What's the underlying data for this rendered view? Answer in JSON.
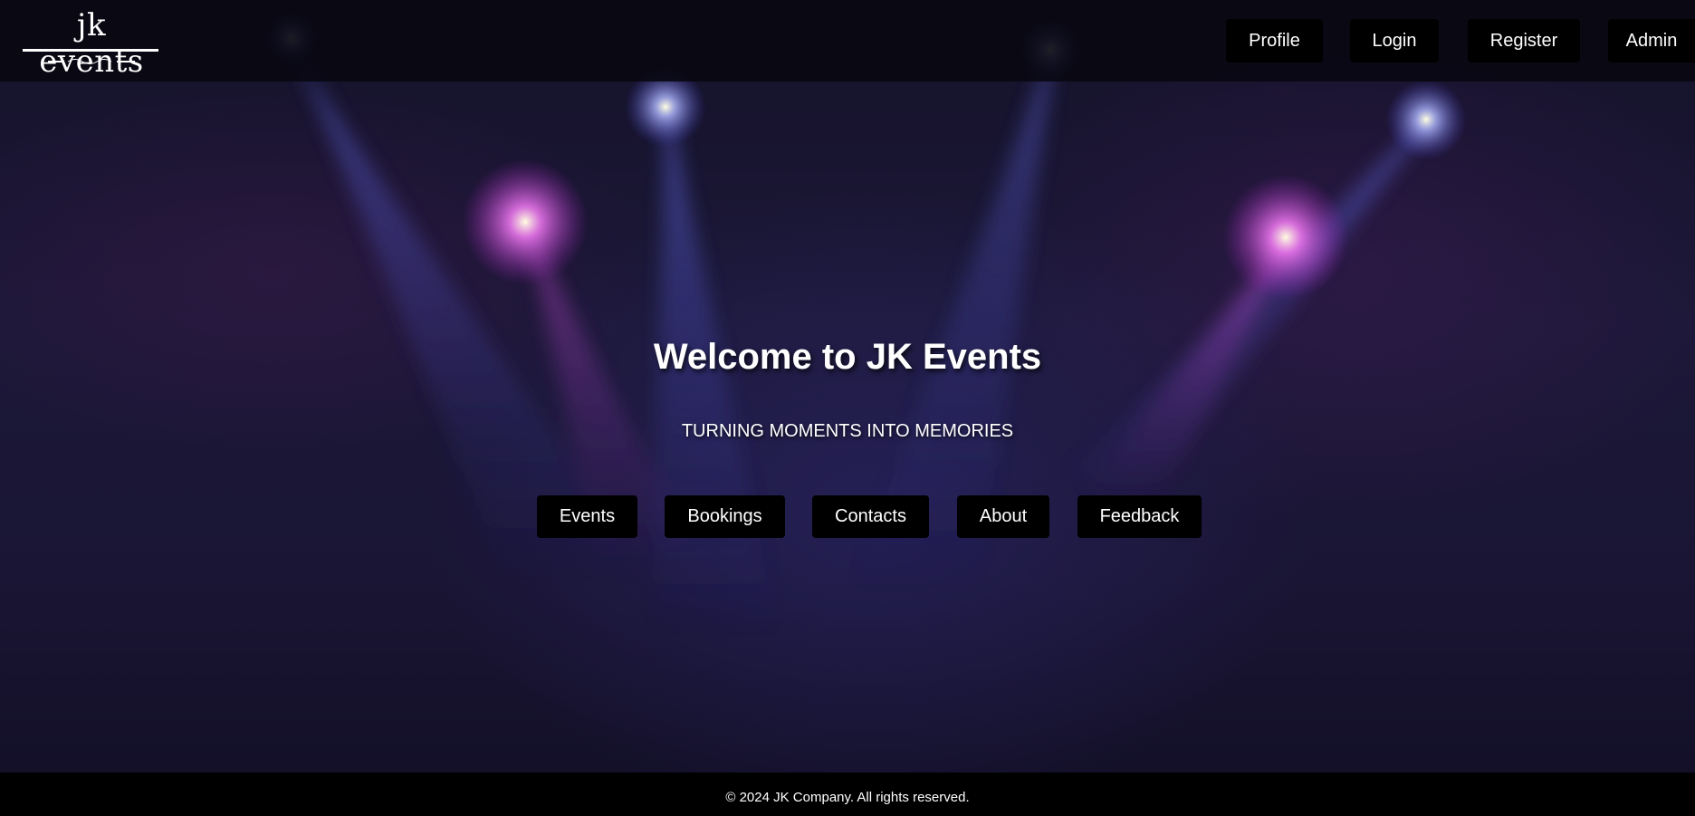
{
  "brand": {
    "logo_text": "jk events"
  },
  "header": {
    "nav": [
      {
        "label": "Profile"
      },
      {
        "label": "Login"
      },
      {
        "label": "Register"
      },
      {
        "label": "Admin"
      }
    ]
  },
  "hero": {
    "title": "Welcome to JK Events",
    "tagline": "TURNING MOMENTS INTO MEMORIES",
    "buttons": [
      {
        "label": "Events"
      },
      {
        "label": "Bookings"
      },
      {
        "label": "Contacts"
      },
      {
        "label": "About"
      },
      {
        "label": "Feedback"
      }
    ]
  },
  "footer": {
    "copyright": "© 2024 JK Company. All rights reserved."
  },
  "colors": {
    "background": "#15122a",
    "button": "#000000",
    "button_text": "#ffffff",
    "spot_blue": "#4a5ad8",
    "spot_pink": "#c040d0"
  },
  "icons": {
    "logo_ornament": "flourish-ornament"
  }
}
